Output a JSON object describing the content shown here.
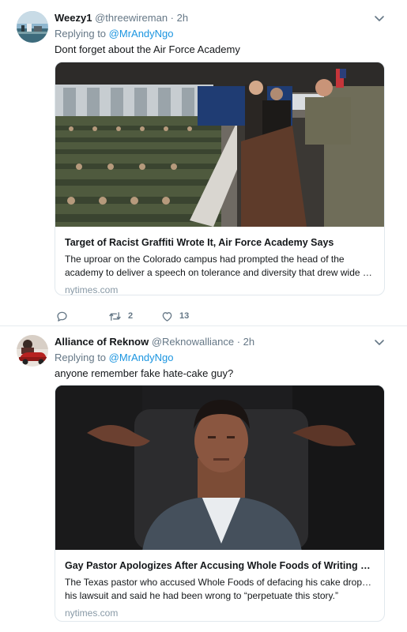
{
  "tweets": [
    {
      "display_name": "Weezy1",
      "handle": "@threewireman",
      "time": "2h",
      "replying_prefix": "Replying to",
      "replying_to": "@MrAndyNgo",
      "text": "Dont forget about the Air Force Academy",
      "card": {
        "title": "Target of Racist Graffiti Wrote It, Air Force Academy Says",
        "description_lines": [
          "The uproar on the Colorado campus had prompted the head of the",
          "academy to deliver a speech on tolerance and diversity that drew wide a..."
        ],
        "source": "nytimes.com"
      },
      "actions": {
        "replies": "",
        "retweets": "2",
        "likes": "13"
      }
    },
    {
      "display_name": "Alliance of Reknow",
      "handle": "@Reknowalliance",
      "time": "2h",
      "replying_prefix": "Replying to",
      "replying_to": "@MrAndyNgo",
      "text": "anyone remember fake hate-cake guy?",
      "card": {
        "title": "Gay Pastor Apologizes After Accusing Whole Foods of Writing Slur ...",
        "description_lines": [
          "The Texas pastor who accused Whole Foods of defacing his cake dropped",
          "his lawsuit and said he had been wrong to “perpetuate this story.”"
        ],
        "source": "nytimes.com"
      }
    }
  ],
  "separator": "·",
  "colors": {
    "link": "#1b95e0",
    "muted": "#657786",
    "border": "#e1e8ed"
  },
  "icons": [
    "chevron-down-icon",
    "reply-icon",
    "retweet-icon",
    "like-icon"
  ]
}
